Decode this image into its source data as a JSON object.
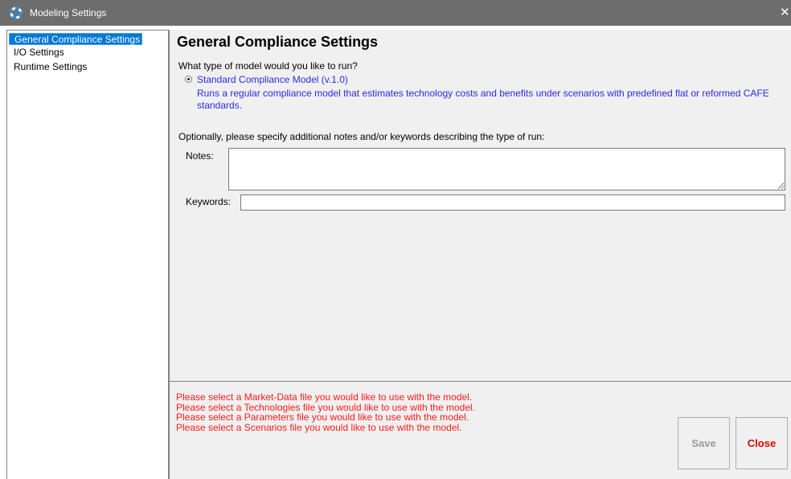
{
  "window": {
    "title": "Modeling Settings",
    "close_glyph": "✕"
  },
  "sidebar": {
    "items": [
      {
        "label": "General Compliance Settings",
        "selected": true
      },
      {
        "label": "I/O Settings",
        "selected": false
      },
      {
        "label": "Runtime Settings",
        "selected": false
      }
    ]
  },
  "main": {
    "title": "General Compliance Settings",
    "question": "What type of model would you like to run?",
    "model_option": {
      "label": "Standard Compliance Model (v.1.0)",
      "description": "Runs a regular compliance model that estimates technology costs and benefits under scenarios with predefined flat or reformed CAFE standards.",
      "selected": true
    },
    "optional_text": "Optionally, please specify additional notes and/or keywords describing the type of run:",
    "notes": {
      "label": "Notes:",
      "value": ""
    },
    "keywords": {
      "label": "Keywords:",
      "value": ""
    }
  },
  "footer": {
    "messages": [
      "Please select a Market-Data file you would like to use with the model.",
      "Please select a Technologies file you would like to use with the model.",
      "Please select a Parameters file you would like to use with the model.",
      "Please select a Scenarios file you would like to use with the model."
    ],
    "save_label": "Save",
    "close_label": "Close"
  },
  "colors": {
    "titlebar": "#6d6d6d",
    "selection": "#0078d7",
    "option_text": "#2a2ae6",
    "error_text": "#ff1a1a",
    "close_button_text": "#e00000",
    "disabled_text": "#9a9a9a"
  },
  "icons": {
    "app": "gear-app-icon",
    "close": "close-icon"
  }
}
